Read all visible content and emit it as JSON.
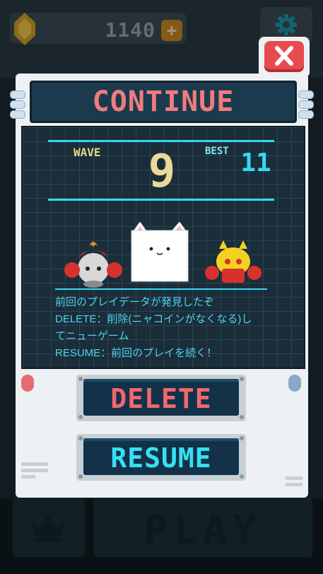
{
  "hud": {
    "coins": "1140",
    "plus_icon": "plus-icon",
    "gem_icon": "gem-icon",
    "settings_icon": "gear-icon"
  },
  "modal": {
    "title": "CONTINUE",
    "close_icon": "close-icon",
    "wave_label": "WAVE",
    "wave_value": "9",
    "best_label": "BEST",
    "best_value": "11",
    "message": {
      "line1": "前回のプレイデータが発見したぞ",
      "line2": "DELETE：削除(ニャコインがなくなる)し",
      "line3": "てニューゲーム",
      "line4": "RESUME：前回のプレイを続く！"
    },
    "delete_label": "DELETE",
    "resume_label": "RESUME"
  },
  "bottom": {
    "play_label": "PLAY",
    "crown_icon": "crown-icon"
  },
  "colors": {
    "title": "#f07b7e",
    "delete": "#f0686e",
    "resume": "#36e0f2",
    "accent_line": "#35d9f0",
    "wave": "#ecd89a"
  }
}
